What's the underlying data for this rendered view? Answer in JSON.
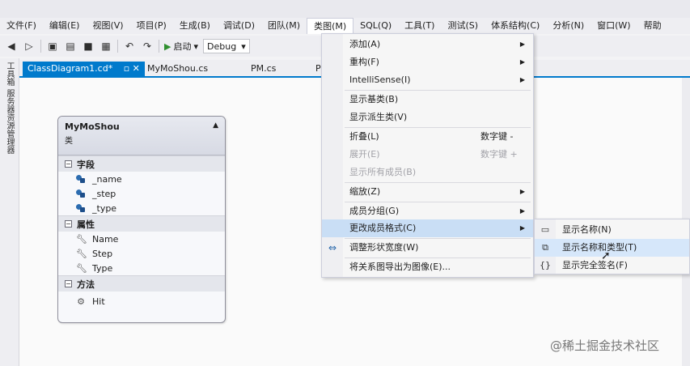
{
  "menubar": {
    "items": [
      "文件(F)",
      "编辑(E)",
      "视图(V)",
      "项目(P)",
      "生成(B)",
      "调试(D)",
      "团队(M)",
      "类图(M)",
      "SQL(Q)",
      "工具(T)",
      "测试(S)",
      "体系结构(C)",
      "分析(N)",
      "窗口(W)",
      "帮助"
    ],
    "active_index": 7
  },
  "toolbar": {
    "start_label": "启动",
    "config_value": "Debug"
  },
  "side_rail": {
    "toolbox_label": "工具箱",
    "server_label": "服务器资源管理器"
  },
  "tabs": [
    {
      "label": "ClassDiagram1.cd*",
      "active": true
    },
    {
      "label": "MyMoShou.cs",
      "active": false
    },
    {
      "label": "PM.cs",
      "active": false
    },
    {
      "label": "P",
      "active": false
    }
  ],
  "class_shape": {
    "name": "MyMoShou",
    "kind": "类",
    "sections": [
      {
        "title": "字段",
        "members": [
          "_name",
          "_step",
          "_type"
        ],
        "icon": "field-icon"
      },
      {
        "title": "属性",
        "members": [
          "Name",
          "Step",
          "Type"
        ],
        "icon": "wrench-icon"
      },
      {
        "title": "方法",
        "members": [
          "Hit"
        ],
        "icon": "method-icon"
      }
    ]
  },
  "dropdown": {
    "items": [
      {
        "label": "添加(A)",
        "submenu": true
      },
      {
        "label": "重构(F)",
        "submenu": true
      },
      {
        "label": "IntelliSense(I)",
        "submenu": true
      },
      {
        "label": "显示基类(B)"
      },
      {
        "label": "显示派生类(V)"
      },
      {
        "label": "折叠(L)",
        "shortcut": "数字键 -"
      },
      {
        "label": "展开(E)",
        "shortcut": "数字键 +",
        "disabled": true
      },
      {
        "label": "显示所有成员(B)",
        "disabled": true
      },
      {
        "label": "缩放(Z)",
        "submenu": true
      },
      {
        "label": "成员分组(G)",
        "submenu": true
      },
      {
        "label": "更改成员格式(C)",
        "submenu": true,
        "highlighted": true
      },
      {
        "label": "调整形状宽度(W)",
        "icon": "resize-icon"
      },
      {
        "label": "将关系图导出为图像(E)..."
      }
    ]
  },
  "submenu": {
    "items": [
      {
        "label": "显示名称(N)",
        "icon": "name-icon"
      },
      {
        "label": "显示名称和类型(T)",
        "icon": "name-type-icon",
        "highlighted": true
      },
      {
        "label": "显示完全签名(F)",
        "icon": "signature-icon"
      }
    ]
  },
  "watermark": "@稀土掘金技术社区"
}
